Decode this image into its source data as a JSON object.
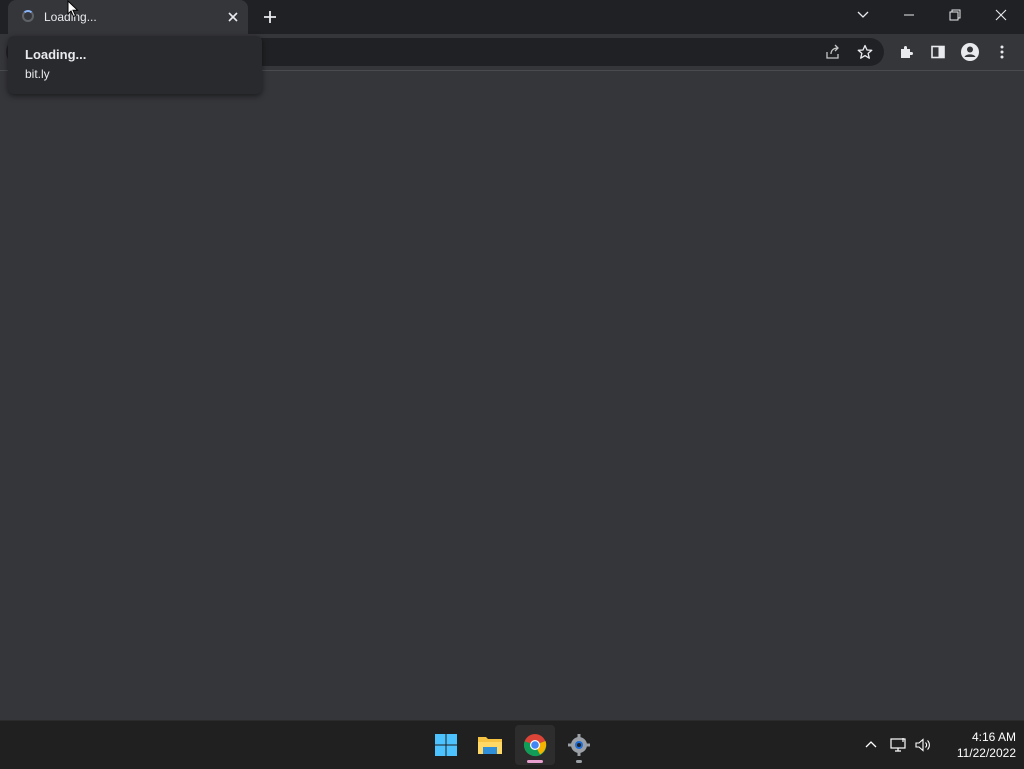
{
  "tab": {
    "title": "Loading..."
  },
  "hovercard": {
    "title": "Loading...",
    "domain": "bit.ly"
  },
  "clock": {
    "time": "4:16 AM",
    "date": "11/22/2022"
  },
  "colors": {
    "chrome_active_indicator": "#e8a0d0",
    "windows_blue": "#4cc2ff",
    "folder_yellow": "#f6c343"
  },
  "icons": [
    "tab-loading-spinner",
    "close-icon",
    "plus-icon",
    "chevron-down-icon",
    "minimize-icon",
    "restore-icon",
    "close-window-icon",
    "share-icon",
    "star-icon",
    "extensions-icon",
    "side-panel-icon",
    "profile-icon",
    "more-vert-icon",
    "windows-start-icon",
    "file-explorer-icon",
    "chrome-icon",
    "settings-icon",
    "chevron-up-icon",
    "network-icon",
    "volume-icon"
  ]
}
